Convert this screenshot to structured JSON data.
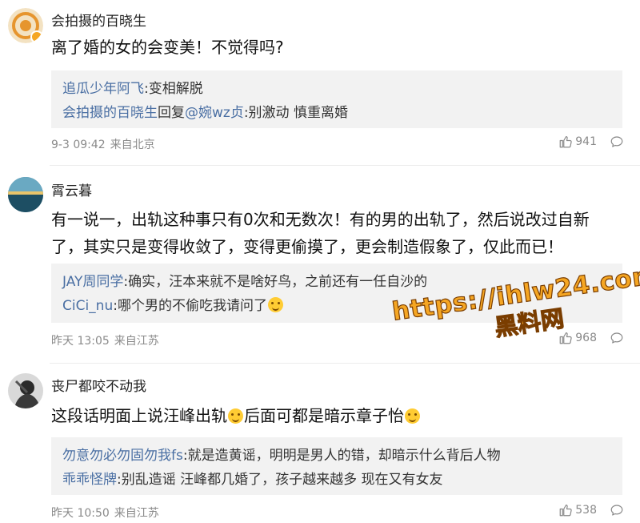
{
  "comments": [
    {
      "username": "会拍摄的百晓生",
      "text": "离了婚的女的会变美！不觉得吗?",
      "replies": [
        {
          "user": "追瓜少年阿飞",
          "text": ":变相解脱"
        },
        {
          "user": "会拍摄的百晓生",
          "reply_word": "回复",
          "mention": "@婉wz贞",
          "text": ":别激动 慎重离婚"
        }
      ],
      "time": "9-3 09:42",
      "location": "来自北京",
      "likes": "941"
    },
    {
      "username": "霄云暮",
      "text": "有一说一，出轨这种事只有0次和无数次！有的男的出轨了，然后说改过自新了，其实只是变得收敛了，变得更偷摸了，更会制造假象了，仅此而已！",
      "replies": [
        {
          "user": "JAY周同学",
          "text": ":确实，汪本来就不是啥好鸟，之前还有一任自沙的"
        },
        {
          "user": "CiCi_nu",
          "text": ":哪个男的不偷吃我请问了"
        }
      ],
      "time": "昨天 13:05",
      "location": "来自江苏",
      "likes": "968"
    },
    {
      "username": "丧尸都咬不动我",
      "text_part1": "这段话明面上说汪峰出轨",
      "text_part2": "后面可都是暗示章子怡",
      "replies": [
        {
          "user": "勿意勿必勿固勿我fs",
          "text": ":就是造黄谣，明明是男人的错，却暗示什么背后人物"
        },
        {
          "user": "乖乖怪牌",
          "text": ":别乱造谣 汪峰都几婚了，孩子越来越多 现在又有女友"
        }
      ],
      "time": "昨天 10:50",
      "location": "来自江苏",
      "likes": "538"
    }
  ],
  "watermark": {
    "url": "https://ihlw24.com",
    "name": "黑料网"
  },
  "icons": {
    "like": "thumbs-up-icon",
    "comment": "comment-bubble-icon",
    "emoji": "laughing-emoji-icon"
  }
}
